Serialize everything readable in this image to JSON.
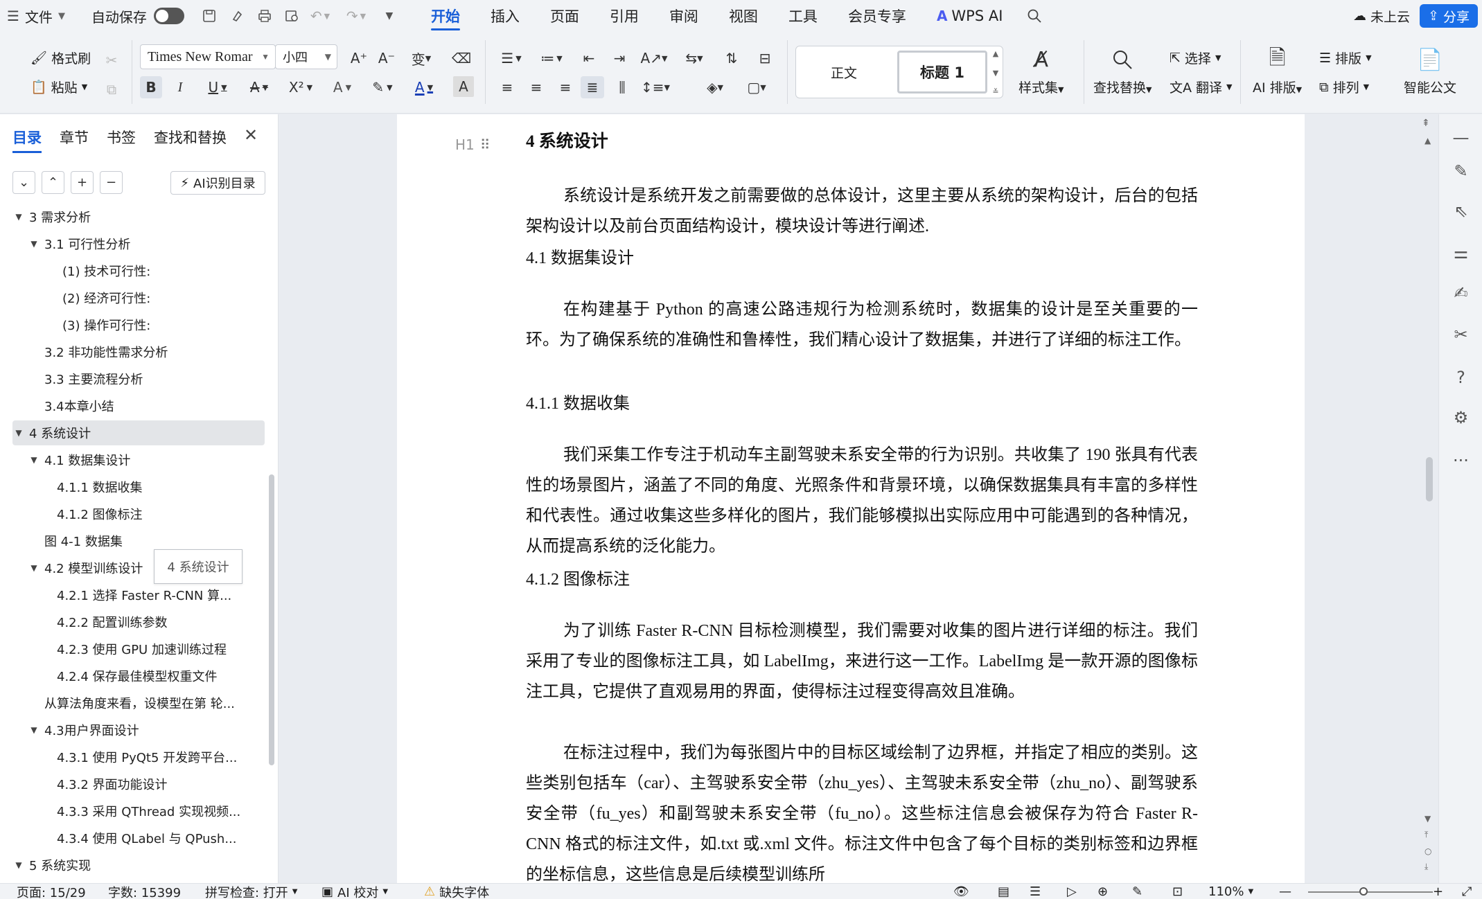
{
  "menubar": {
    "file_label": "文件",
    "autosave_label": "自动保存",
    "tabs": [
      "开始",
      "插入",
      "页面",
      "引用",
      "审阅",
      "视图",
      "工具",
      "会员专享"
    ],
    "wps_ai_label": "WPS AI",
    "cloud_label": "未上云",
    "share_label": "分享"
  },
  "ribbon": {
    "format_painter": "格式刷",
    "paste": "粘贴",
    "font_name": "Times New Romar",
    "font_size": "小四",
    "style_normal": "正文",
    "style_heading1": "标题 1",
    "style_set": "样式集",
    "find_replace": "查找替换",
    "select": "选择",
    "translate": "翻译",
    "ai_layout": "AI 排版",
    "layout": "排版",
    "arrange": "排列",
    "smart_doc": "智能公文"
  },
  "nav": {
    "tabs": [
      "目录",
      "章节",
      "书签",
      "查找和替换"
    ],
    "ai_toc_label": "AI识别目录",
    "tooltip": "4 系统设计",
    "items": [
      {
        "label": "3 需求分析",
        "level": 0,
        "expanded": true
      },
      {
        "label": "3.1 可行性分析",
        "level": 1,
        "expanded": true
      },
      {
        "label": "(1) 技术可行性:",
        "level": 3
      },
      {
        "label": "(2) 经济可行性:",
        "level": 3
      },
      {
        "label": "(3) 操作可行性:",
        "level": 3
      },
      {
        "label": "3.2 非功能性需求分析",
        "level": 1
      },
      {
        "label": "3.3 主要流程分析",
        "level": 1
      },
      {
        "label": "3.4本章小结",
        "level": 1
      },
      {
        "label": "4 系统设计",
        "level": 0,
        "expanded": true,
        "selected": true
      },
      {
        "label": "4.1 数据集设计",
        "level": 1,
        "expanded": true
      },
      {
        "label": "4.1.1 数据收集",
        "level": 2
      },
      {
        "label": "4.1.2 图像标注",
        "level": 2
      },
      {
        "label": "图 4-1 数据集",
        "level": 1
      },
      {
        "label": "4.2 模型训练设计",
        "level": 1,
        "expanded": true
      },
      {
        "label": "4.2.1 选择 Faster R-CNN 算...",
        "level": 2
      },
      {
        "label": "4.2.2 配置训练参数",
        "level": 2
      },
      {
        "label": "4.2.3 使用 GPU 加速训练过程",
        "level": 2
      },
      {
        "label": "4.2.4 保存最佳模型权重文件",
        "level": 2
      },
      {
        "label": "从算法角度来看，设模型在第 轮...",
        "level": 1
      },
      {
        "label": "4.3用户界面设计",
        "level": 1,
        "expanded": true
      },
      {
        "label": "4.3.1 使用 PyQt5 开发跨平台...",
        "level": 2
      },
      {
        "label": "4.3.2 界面功能设计",
        "level": 2
      },
      {
        "label": "4.3.3 采用 QThread 实现视频...",
        "level": 2
      },
      {
        "label": "4.3.4 使用 QLabel 与 QPush...",
        "level": 2
      },
      {
        "label": "5 系统实现",
        "level": 0,
        "expanded": true
      }
    ]
  },
  "document": {
    "heading_marker": "H1",
    "h1": "4  系统设计",
    "p1": "系统设计是系统开发之前需要做的总体设计，这里主要从系统的架构设计，后台的包括架构设计以及前台页面结构设计，模块设计等进行阐述.",
    "h2_1": "4.1  数据集设计",
    "p2": "在构建基于 Python 的高速公路违规行为检测系统时，数据集的设计是至关重要的一环。为了确保系统的准确性和鲁棒性，我们精心设计了数据集，并进行了详细的标注工作。",
    "h3_1": "4.1.1 数据收集",
    "p3": "我们采集工作专注于机动车主副驾驶未系安全带的行为识别。共收集了 190 张具有代表性的场景图片，涵盖了不同的角度、光照条件和背景环境，以确保数据集具有丰富的多样性和代表性。通过收集这些多样化的图片，我们能够模拟出实际应用中可能遇到的各种情况，从而提高系统的泛化能力。",
    "h3_2": "4.1.2 图像标注",
    "p4": "为了训练 Faster R-CNN 目标检测模型，我们需要对收集的图片进行详细的标注。我们采用了专业的图像标注工具，如 LabelImg，来进行这一工作。LabelImg 是一款开源的图像标注工具，它提供了直观易用的界面，使得标注过程变得高效且准确。",
    "p5": "在标注过程中，我们为每张图片中的目标区域绘制了边界框，并指定了相应的类别。这些类别包括车（car）、主驾驶系安全带（zhu_yes）、主驾驶未系安全带（zhu_no）、副驾驶系安全带（fu_yes）和副驾驶未系安全带（fu_no）。这些标注信息会被保存为符合 Faster R-CNN 格式的标注文件，如.txt 或.xml 文件。标注文件中包含了每个目标的类别标签和边界框的坐标信息，这些信息是后续模型训练所"
  },
  "status": {
    "page": "页面: 15/29",
    "words": "字数: 15399",
    "spell": "拼写检查: 打开",
    "ai_check": "AI 校对",
    "missing_font": "缺失字体",
    "zoom": "110%"
  },
  "colors": {
    "accent": "#1a5fd8",
    "share_bg": "#1a6ee8",
    "wps_ai": "#4b5cf0"
  }
}
